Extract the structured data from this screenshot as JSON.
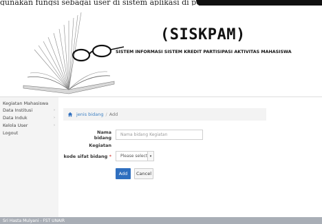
{
  "top_caption": "gunakan fungsi sebagai user di sistem aplikasi di perangkat",
  "header": {
    "brand": "(SISKPAM)",
    "subtitle": "SISTEM INFORMASI SISTEM KREDIT PARTISIPASI AKTIVITAS MAHASISWA",
    "logo_icon": "open-book-with-glasses"
  },
  "sidebar": {
    "items": [
      {
        "label": "Kegiatan Mahasiswa",
        "chevron": ""
      },
      {
        "label": "Data Institusi",
        "chevron": "›"
      },
      {
        "label": "Data Induk",
        "chevron": "›"
      },
      {
        "label": "Kelola User",
        "chevron": "›"
      },
      {
        "label": "Logout",
        "chevron": ""
      }
    ]
  },
  "breadcrumb": {
    "icon": "home-icon",
    "link": "jenis bidang",
    "separator": "/",
    "current": "Add"
  },
  "form": {
    "nama_label_1": "Nama bidang",
    "nama_label_2": "Kegiatan",
    "nama_placeholder": "Nama bidang Kegiatan",
    "kode_label": "kode sifat bidang",
    "required_mark": "*",
    "kode_selected": "Please select",
    "add_label": "Add",
    "cancel_label": "Cancel"
  },
  "footer": {
    "text": "Sri Hasta Mulyani - FST UNAIR"
  },
  "colors": {
    "primary_button": "#2f6fbf",
    "link": "#3a7fc3",
    "required": "#d9534f",
    "footer_bg": "#a9aeb6"
  }
}
